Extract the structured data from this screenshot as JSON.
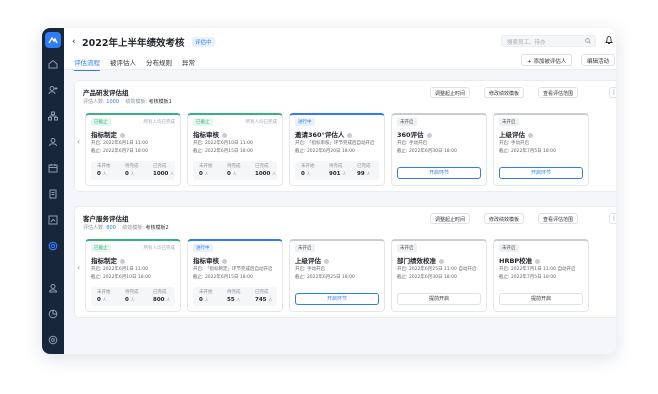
{
  "app": {
    "title": "2022年上半年绩效考核",
    "status_badge": "评估中",
    "back_glyph": "‹"
  },
  "search": {
    "placeholder": "搜索员工、待办"
  },
  "tabs": [
    {
      "label": "评估流程"
    },
    {
      "label": "被评估人"
    },
    {
      "label": "分布规则"
    },
    {
      "label": "异常"
    }
  ],
  "actions": {
    "add_person": "+ 添加被评估人",
    "edit_activity": "编辑活动",
    "more": "⋮"
  },
  "group_actions": {
    "adjust_time": "调整起止时间",
    "edit_template": "修改绩效模板",
    "view_scope": "查看评估范围",
    "more": "⋮"
  },
  "groups": [
    {
      "name": "产品研发评估组",
      "count_label": "评估人数:",
      "count": "1000",
      "template_label": "绩效模板:",
      "template": "考核模板1",
      "cards": [
        {
          "status": "已截止",
          "note": "所有人均已完成",
          "name": "指标制定",
          "l1": "开启: 2022年6月1日 11:00",
          "l2": "截止: 2022年6月7日 18:00",
          "s": [
            {
              "k": "未开始",
              "v": "0",
              "u": "人"
            },
            {
              "k": "待完成",
              "v": "0",
              "u": "人"
            },
            {
              "k": "已完成",
              "v": "1000",
              "u": "人"
            }
          ]
        },
        {
          "status": "已截止",
          "note": "所有人均已完成",
          "name": "指标审核",
          "l1": "开启: 2022年6月10日 11:00",
          "l2": "截止: 2022年6月15日 18:00",
          "s": [
            {
              "k": "未开始",
              "v": "0",
              "u": "人"
            },
            {
              "k": "待完成",
              "v": "0",
              "u": "人"
            },
            {
              "k": "已完成",
              "v": "1000",
              "u": "人"
            }
          ]
        },
        {
          "status": "进行中",
          "note": "",
          "name": "邀请360°评估人",
          "l1": "开启: 「指标审核」环节完成后自动开启",
          "l2": "截止: 2022年6月20日 18:00",
          "s": [
            {
              "k": "未开始",
              "v": "0",
              "u": "人"
            },
            {
              "k": "待完成",
              "v": "901",
              "u": "人"
            },
            {
              "k": "已完成",
              "v": "99",
              "u": "人"
            }
          ]
        },
        {
          "status": "未开启",
          "note": "",
          "name": "360评估",
          "l1": "开启: 手动开启",
          "l2": "截止: 2022年6月30日 18:00",
          "btn": "开启环节"
        },
        {
          "status": "未开启",
          "note": "",
          "name": "上级评估",
          "l1": "开启: 手动开启",
          "l2": "截止: 2022年7月5日 18:00",
          "btn": "开启环节"
        }
      ]
    },
    {
      "name": "客户服务评估组",
      "count_label": "评估人数:",
      "count": "800",
      "template_label": "绩效模板:",
      "template": "考核模板2",
      "cards": [
        {
          "status": "已截止",
          "note": "所有人均已完成",
          "name": "指标制定",
          "l1": "开启: 2022年6月1日 11:00",
          "l2": "截止: 2022年6月10日 18:00",
          "s": [
            {
              "k": "未开始",
              "v": "0",
              "u": "人"
            },
            {
              "k": "待完成",
              "v": "0",
              "u": "人"
            },
            {
              "k": "已完成",
              "v": "800",
              "u": "人"
            }
          ]
        },
        {
          "status": "进行中",
          "note": "",
          "name": "指标审核",
          "l1": "开启: 「指标制定」环节完成后自动开启",
          "l2": "截止: 2022年6月15日 18:00",
          "s": [
            {
              "k": "未开始",
              "v": "0",
              "u": "人"
            },
            {
              "k": "待完成",
              "v": "55",
              "u": "人"
            },
            {
              "k": "已完成",
              "v": "745",
              "u": "人"
            }
          ]
        },
        {
          "status": "未开启",
          "note": "",
          "name": "上级评估",
          "l1": "开启: 手动开启",
          "l2": "截止: 2022年6月25日 18:00",
          "btn": "开启环节"
        },
        {
          "status": "未开启",
          "note": "",
          "name": "部门绩效校准",
          "l1": "开启: 2022年6月25日 11:00 自动开启",
          "l2": "截止: 2022年6月30日 18:00",
          "btn": "提前开启"
        },
        {
          "status": "未开启",
          "note": "",
          "name": "HRBP校准",
          "l1": "开启: 2022年7月1日 11:00 自动开启",
          "l2": "截止: 2022年7月5日 18:00",
          "btn": "提前开启"
        }
      ]
    }
  ],
  "nav_icons": [
    "home-icon",
    "user-add-icon",
    "org-icon",
    "person-icon",
    "calendar-icon",
    "document-icon",
    "chart-icon",
    "target-icon",
    "user-icon",
    "pie-icon",
    "settings-icon"
  ]
}
